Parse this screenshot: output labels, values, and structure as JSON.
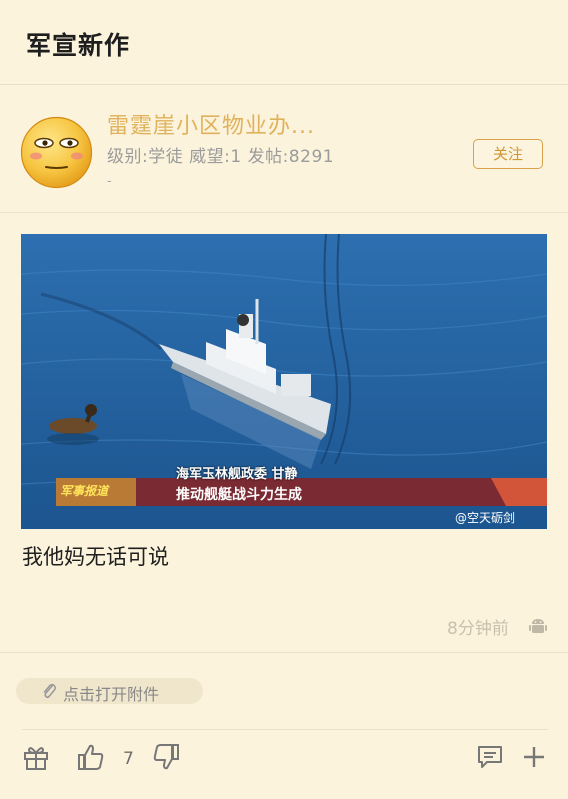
{
  "header": {
    "title": "军宣新作"
  },
  "user": {
    "name": "雷霆崖小区物业办...",
    "meta": "级别:学徒 威望:1 发帖:8291",
    "dash": "-",
    "follow_label": "关注"
  },
  "post": {
    "image": {
      "caption_line1": "海军玉林舰政委  甘静",
      "caption_line2": "推动舰艇战斗力生成",
      "banner_badge": "军事报道",
      "watermark": "@空天砺剑"
    },
    "text": "我他妈无话可说",
    "time": "8分钟前",
    "attachment_label": "点击打开附件"
  },
  "toolbar": {
    "like_count": "7"
  },
  "icons": {
    "avatar": "smiley-face-avatar",
    "device": "android-icon",
    "attachment": "paperclip-icon",
    "gift": "gift-icon",
    "like": "thumbs-up-icon",
    "dislike": "thumbs-down-icon",
    "comment": "comment-icon",
    "more": "plus-icon"
  },
  "colors": {
    "background": "#fbf3dc",
    "username": "#e0b25c",
    "follow_border": "#d8a24a",
    "muted": "#9b9b9b"
  }
}
